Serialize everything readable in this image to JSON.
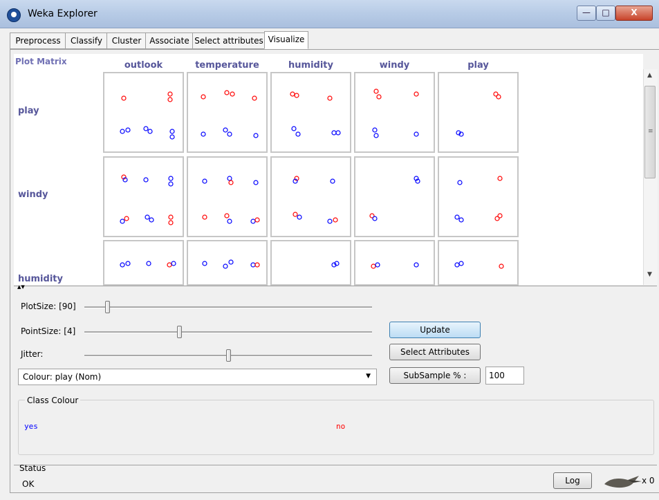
{
  "window": {
    "title": "Weka Explorer",
    "minimize": "—",
    "maximize": "□",
    "close": "X"
  },
  "tabs": [
    "Preprocess",
    "Classify",
    "Cluster",
    "Associate",
    "Select attributes",
    "Visualize"
  ],
  "active_tab": "Visualize",
  "plot_matrix": {
    "title": "Plot Matrix",
    "columns": [
      "outlook",
      "temperature",
      "humidity",
      "windy",
      "play"
    ],
    "rows": [
      "play",
      "windy",
      "humidity"
    ]
  },
  "controls": {
    "plotsize_label": "PlotSize: [90]",
    "pointsize_label": "PointSize: [4]",
    "jitter_label": "Jitter:",
    "plotsize_level": 0.08,
    "pointsize_level": 0.33,
    "jitter_level": 0.5,
    "colour_select": "Colour: play (Nom)",
    "update_button": "Update",
    "select_attributes_button": "Select Attributes",
    "subsample_button": "SubSample % :",
    "subsample_value": "100"
  },
  "class_colour": {
    "title": "Class Colour",
    "classes": [
      {
        "name": "yes",
        "color": "#0000ff"
      },
      {
        "name": "no",
        "color": "#ff0000"
      }
    ]
  },
  "status": {
    "label": "Status",
    "text": "OK",
    "log_button": "Log",
    "count": "x 0"
  },
  "colors": {
    "yes": "#0000ff",
    "no": "#ff0000",
    "header": "#56569a"
  }
}
